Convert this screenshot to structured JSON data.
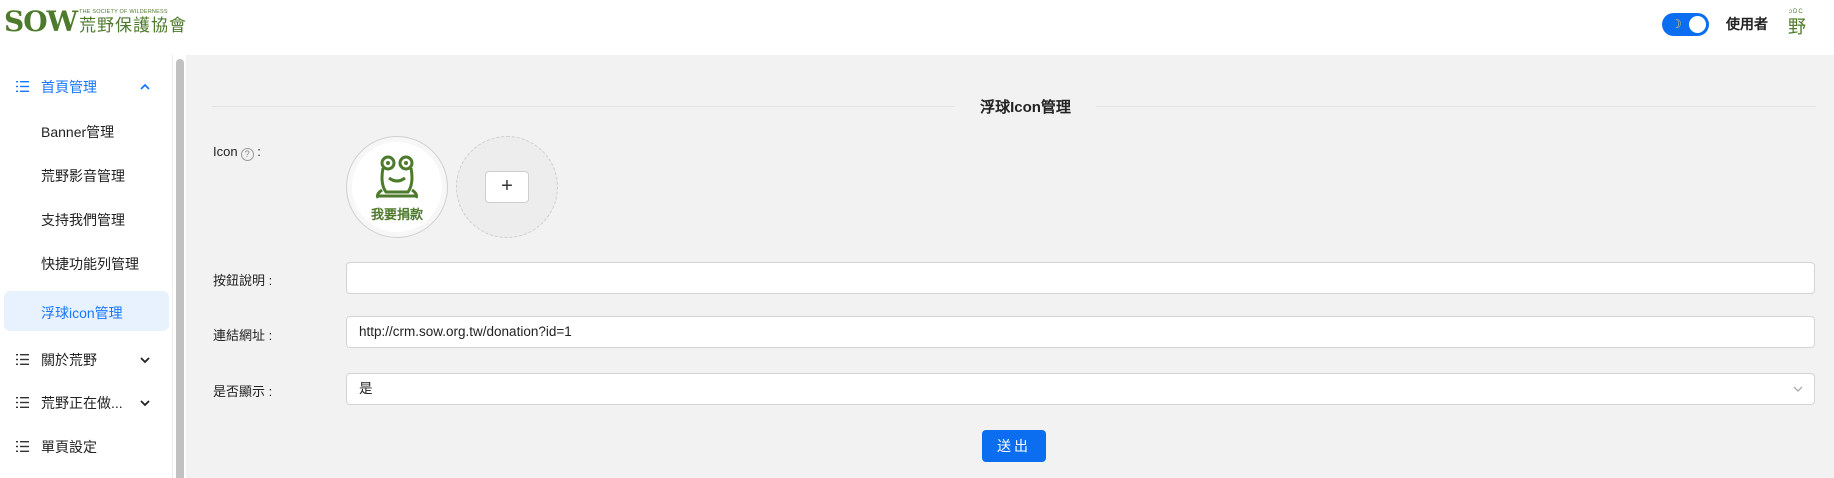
{
  "header": {
    "logo_mark": "SOW",
    "logo_en": "THE SOCIETY OF WILDERNESS",
    "logo_zh": "荒野保護協會",
    "user_label": "使用者",
    "avatar_small": "ɔDC",
    "avatar_char": "野"
  },
  "sidebar": {
    "groups": [
      {
        "label": "首頁管理",
        "expanded": true
      },
      {
        "label": "關於荒野",
        "expanded": false
      },
      {
        "label": "荒野正在做...",
        "expanded": false
      },
      {
        "label": "單頁設定"
      }
    ],
    "sub_items": [
      {
        "label": "Banner管理"
      },
      {
        "label": "荒野影音管理"
      },
      {
        "label": "支持我們管理"
      },
      {
        "label": "快捷功能列管理"
      },
      {
        "label": "浮球icon管理",
        "selected": true
      }
    ]
  },
  "main": {
    "section_title": "浮球Icon管理",
    "icon_label": "Icon",
    "icon_help": "?",
    "icon_colon": ":",
    "uploaded_icon_caption": "我要捐款",
    "add_symbol": "+",
    "button_desc_label": "按鈕說明 :",
    "button_desc_value": "",
    "link_label": "連結網址 :",
    "link_value": "http://crm.sow.org.tw/donation?id=1",
    "display_label": "是否顯示 :",
    "display_value": "是",
    "submit_label": "送出"
  },
  "colors": {
    "accent": "#0b6ef0",
    "brand_green": "#4e7a2c",
    "active_text": "#1677ff"
  }
}
